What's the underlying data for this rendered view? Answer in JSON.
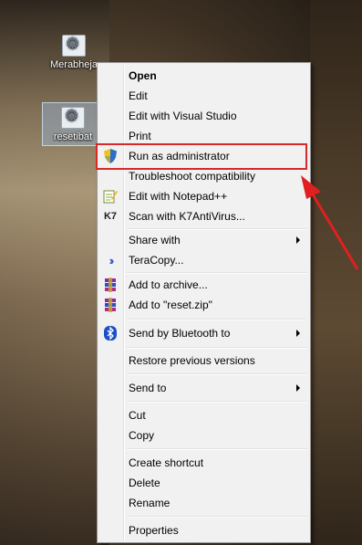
{
  "desktop": {
    "icons": [
      {
        "label": "Merabheja"
      },
      {
        "label": "resetibat"
      }
    ]
  },
  "context_menu": {
    "items": [
      {
        "label": "Open",
        "icon": "",
        "bold": true
      },
      {
        "label": "Edit"
      },
      {
        "label": "Edit with Visual Studio"
      },
      {
        "label": "Print"
      },
      {
        "label": "Run as administrator",
        "icon": "uac-shield-icon",
        "highlighted": true
      },
      {
        "label": "Troubleshoot compatibility"
      },
      {
        "label": "Edit with Notepad++",
        "icon": "notepad-plus-plus-icon"
      },
      {
        "label": "Scan with K7AntiVirus...",
        "icon": "k7-antivirus-icon"
      },
      {
        "label": "Share with",
        "submenu": true
      },
      {
        "label": "TeraCopy...",
        "icon": "teracopy-icon"
      },
      {
        "label": "Add to archive...",
        "icon": "winrar-icon"
      },
      {
        "label": "Add to \"reset.zip\"",
        "icon": "winrar-icon"
      },
      {
        "label": "Send by Bluetooth to",
        "icon": "bluetooth-icon",
        "submenu": true
      },
      {
        "label": "Restore previous versions"
      },
      {
        "label": "Send to",
        "submenu": true
      },
      {
        "label": "Cut"
      },
      {
        "label": "Copy"
      },
      {
        "label": "Create shortcut"
      },
      {
        "label": "Delete"
      },
      {
        "label": "Rename"
      },
      {
        "label": "Properties"
      }
    ]
  },
  "colors": {
    "annotation": "#d42a2a",
    "menu_background": "#f1f1f1"
  }
}
